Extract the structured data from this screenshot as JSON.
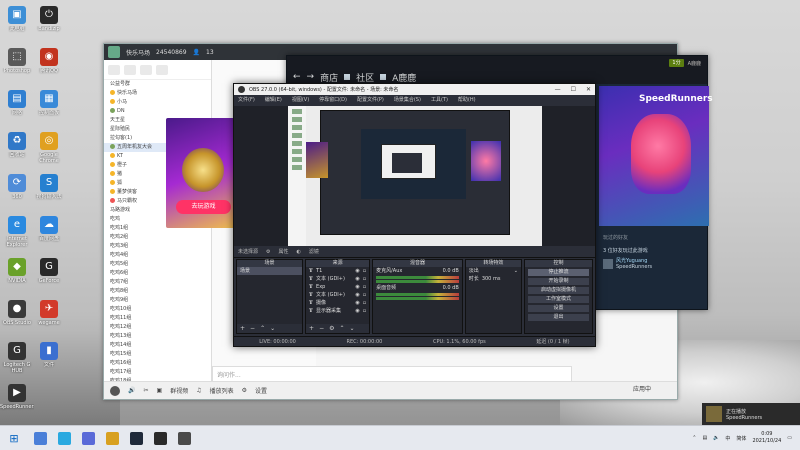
{
  "desktop": {
    "icons": [
      {
        "label": "此电脑",
        "color": "#3d8fd6",
        "glyph": "▣"
      },
      {
        "label": "Bandizip",
        "color": "#2a2a2a",
        "glyph": "⏻"
      },
      {
        "label": "Photoshop",
        "color": "#5a5a5a",
        "glyph": "⬚"
      },
      {
        "label": "腾讯QQ",
        "color": "#c2331e",
        "glyph": "◉"
      },
      {
        "label": "网络",
        "color": "#2f7fd1",
        "glyph": "▤"
      },
      {
        "label": "控制面板",
        "color": "#3a8ad8",
        "glyph": "▦"
      },
      {
        "label": "回收站",
        "color": "#3078c8",
        "glyph": "♻"
      },
      {
        "label": "Google Chrome",
        "color": "#e0a020",
        "glyph": "◎"
      },
      {
        "label": "360",
        "color": "#4f8cd8",
        "glyph": "⟳"
      },
      {
        "label": "搜狗输入法",
        "color": "#2680d0",
        "glyph": "S"
      },
      {
        "label": "Internet Explorer",
        "color": "#2a8ae0",
        "glyph": "e"
      },
      {
        "label": "百度网盘",
        "color": "#2e86de",
        "glyph": "☁"
      },
      {
        "label": "NVIDIA",
        "color": "#6aa12a",
        "glyph": "◆"
      },
      {
        "label": "GeForce",
        "color": "#2a2a2a",
        "glyph": "G"
      },
      {
        "label": "OBS Studio",
        "color": "#3a3a3a",
        "glyph": "●"
      },
      {
        "label": "wegame",
        "color": "#d23a2a",
        "glyph": "✈"
      },
      {
        "label": "Logitech G HUB",
        "color": "#333333",
        "glyph": "G"
      },
      {
        "label": "文件",
        "color": "#3a6fd0",
        "glyph": "▮"
      },
      {
        "label": "SpeedRunners",
        "color": "#333333",
        "glyph": "▶"
      }
    ]
  },
  "qq": {
    "title": "快乐马场",
    "id": "24540869",
    "members": "13",
    "group_label": "公益号群",
    "contacts": [
      {
        "name": "快乐马场",
        "dot": "y",
        "hl": false
      },
      {
        "name": "小马",
        "dot": "y",
        "hl": false
      },
      {
        "name": "DN",
        "dot": "g",
        "hl": false
      },
      {
        "name": "天王星",
        "dot": "",
        "hl": false
      },
      {
        "name": "星际殖民",
        "dot": "",
        "hl": false
      },
      {
        "name": "拉勾客(1)",
        "dot": "",
        "hl": false
      },
      {
        "name": "五周年机友大会",
        "dot": "g",
        "hl": true
      },
      {
        "name": "KT",
        "dot": "y",
        "hl": false
      },
      {
        "name": "橙子",
        "dot": "y",
        "hl": false
      },
      {
        "name": "猪",
        "dot": "y",
        "hl": false
      },
      {
        "name": "狐",
        "dot": "y",
        "hl": false
      },
      {
        "name": "董梦侠客",
        "dot": "y",
        "hl": false
      },
      {
        "name": "马只霸权",
        "dot": "r",
        "hl": false
      },
      {
        "name": "马路游戏",
        "dot": "",
        "hl": false
      },
      {
        "name": "吃鸡",
        "dot": "",
        "hl": false
      },
      {
        "name": "吃鸡1组",
        "dot": "",
        "hl": false
      },
      {
        "name": "吃鸡2组",
        "dot": "",
        "hl": false
      },
      {
        "name": "吃鸡3组",
        "dot": "",
        "hl": false
      },
      {
        "name": "吃鸡4组",
        "dot": "",
        "hl": false
      },
      {
        "name": "吃鸡5组",
        "dot": "",
        "hl": false
      },
      {
        "name": "吃鸡6组",
        "dot": "",
        "hl": false
      },
      {
        "name": "吃鸡7组",
        "dot": "",
        "hl": false
      },
      {
        "name": "吃鸡8组",
        "dot": "",
        "hl": false
      },
      {
        "name": "吃鸡9组",
        "dot": "",
        "hl": false
      },
      {
        "name": "吃鸡10组",
        "dot": "",
        "hl": false
      },
      {
        "name": "吃鸡11组",
        "dot": "",
        "hl": false
      },
      {
        "name": "吃鸡12组",
        "dot": "",
        "hl": false
      },
      {
        "name": "吃鸡13组",
        "dot": "",
        "hl": false
      },
      {
        "name": "吃鸡14组",
        "dot": "",
        "hl": false
      },
      {
        "name": "吃鸡15组",
        "dot": "",
        "hl": false
      },
      {
        "name": "吃鸡16组",
        "dot": "",
        "hl": false
      },
      {
        "name": "吃鸡17组",
        "dot": "",
        "hl": false
      },
      {
        "name": "吃鸡18组",
        "dot": "",
        "hl": false
      }
    ],
    "ad_button": "去玩游戏",
    "chat_lines": [
      "",
      "",
      "",
      "",
      "",
      "",
      "",
      ""
    ],
    "input_placeholder": "询问作...",
    "bottom_actions": [
      "群视频",
      "播放列表",
      "设置"
    ],
    "send_label": "应用中"
  },
  "steam": {
    "nav": [
      "商店",
      "社区",
      "A鹿鹿"
    ],
    "points": "1分",
    "user": "A鹿鹿",
    "game_title": "SpeedRunners",
    "friends_header": "玩过的好友",
    "friends_count": "3 位好友玩过此游戏",
    "friend_name": "风光Yuguang",
    "friend_game": "SpeedRunners"
  },
  "obs": {
    "title": "OBS 27.0.0 (64-bit, windows) - 配置文件: 未命名 - 场景: 未命名",
    "menu": [
      "文件(F)",
      "编辑(E)",
      "视图(V)",
      "停靠窗口(D)",
      "配置文件(P)",
      "场景集合(S)",
      "工具(T)",
      "帮助(H)"
    ],
    "source_bar": [
      "未选择源",
      "属性",
      "滤镜"
    ],
    "docks": {
      "scenes": {
        "title": "场景",
        "items": [
          "场景"
        ]
      },
      "sources": {
        "title": "来源",
        "items": [
          "T1",
          "文本 (GDI+)",
          "Exp",
          "文本 (GDI+)",
          "摄像",
          "显示器采集"
        ]
      },
      "mixer": {
        "title": "混音器",
        "channels": [
          {
            "name": "麦克风/Aux",
            "db": "0.0 dB"
          },
          {
            "name": "桌面音频",
            "db": "0.0 dB"
          }
        ]
      },
      "transitions": {
        "title": "转场特效",
        "type": "淡出",
        "duration_label": "时长",
        "duration": "300 ms"
      },
      "controls": {
        "title": "控制",
        "buttons": [
          "停止推流",
          "开始录制",
          "启动虚拟摄像机",
          "工作室模式",
          "设置",
          "退出"
        ]
      }
    },
    "status": [
      "LIVE: 00:00:00",
      "REC: 00:00:00",
      "CPU: 1.1%, 60.00 fps",
      "延迟 (0 / 1 帧)"
    ]
  },
  "notification": {
    "line1": "正在播放",
    "line2": "SpeedRunners"
  },
  "taskbar": {
    "apps": [
      {
        "color": "#4a7fd8"
      },
      {
        "color": "#2aa9e0"
      },
      {
        "color": "#5a6ad8"
      },
      {
        "color": "#d8a020"
      },
      {
        "color": "#1f2a3a"
      },
      {
        "color": "#2a2a2a"
      },
      {
        "color": "#4a4a4a"
      }
    ],
    "ime": "中",
    "lang": "简体",
    "time": "0:09",
    "date": "2021/10/24"
  }
}
